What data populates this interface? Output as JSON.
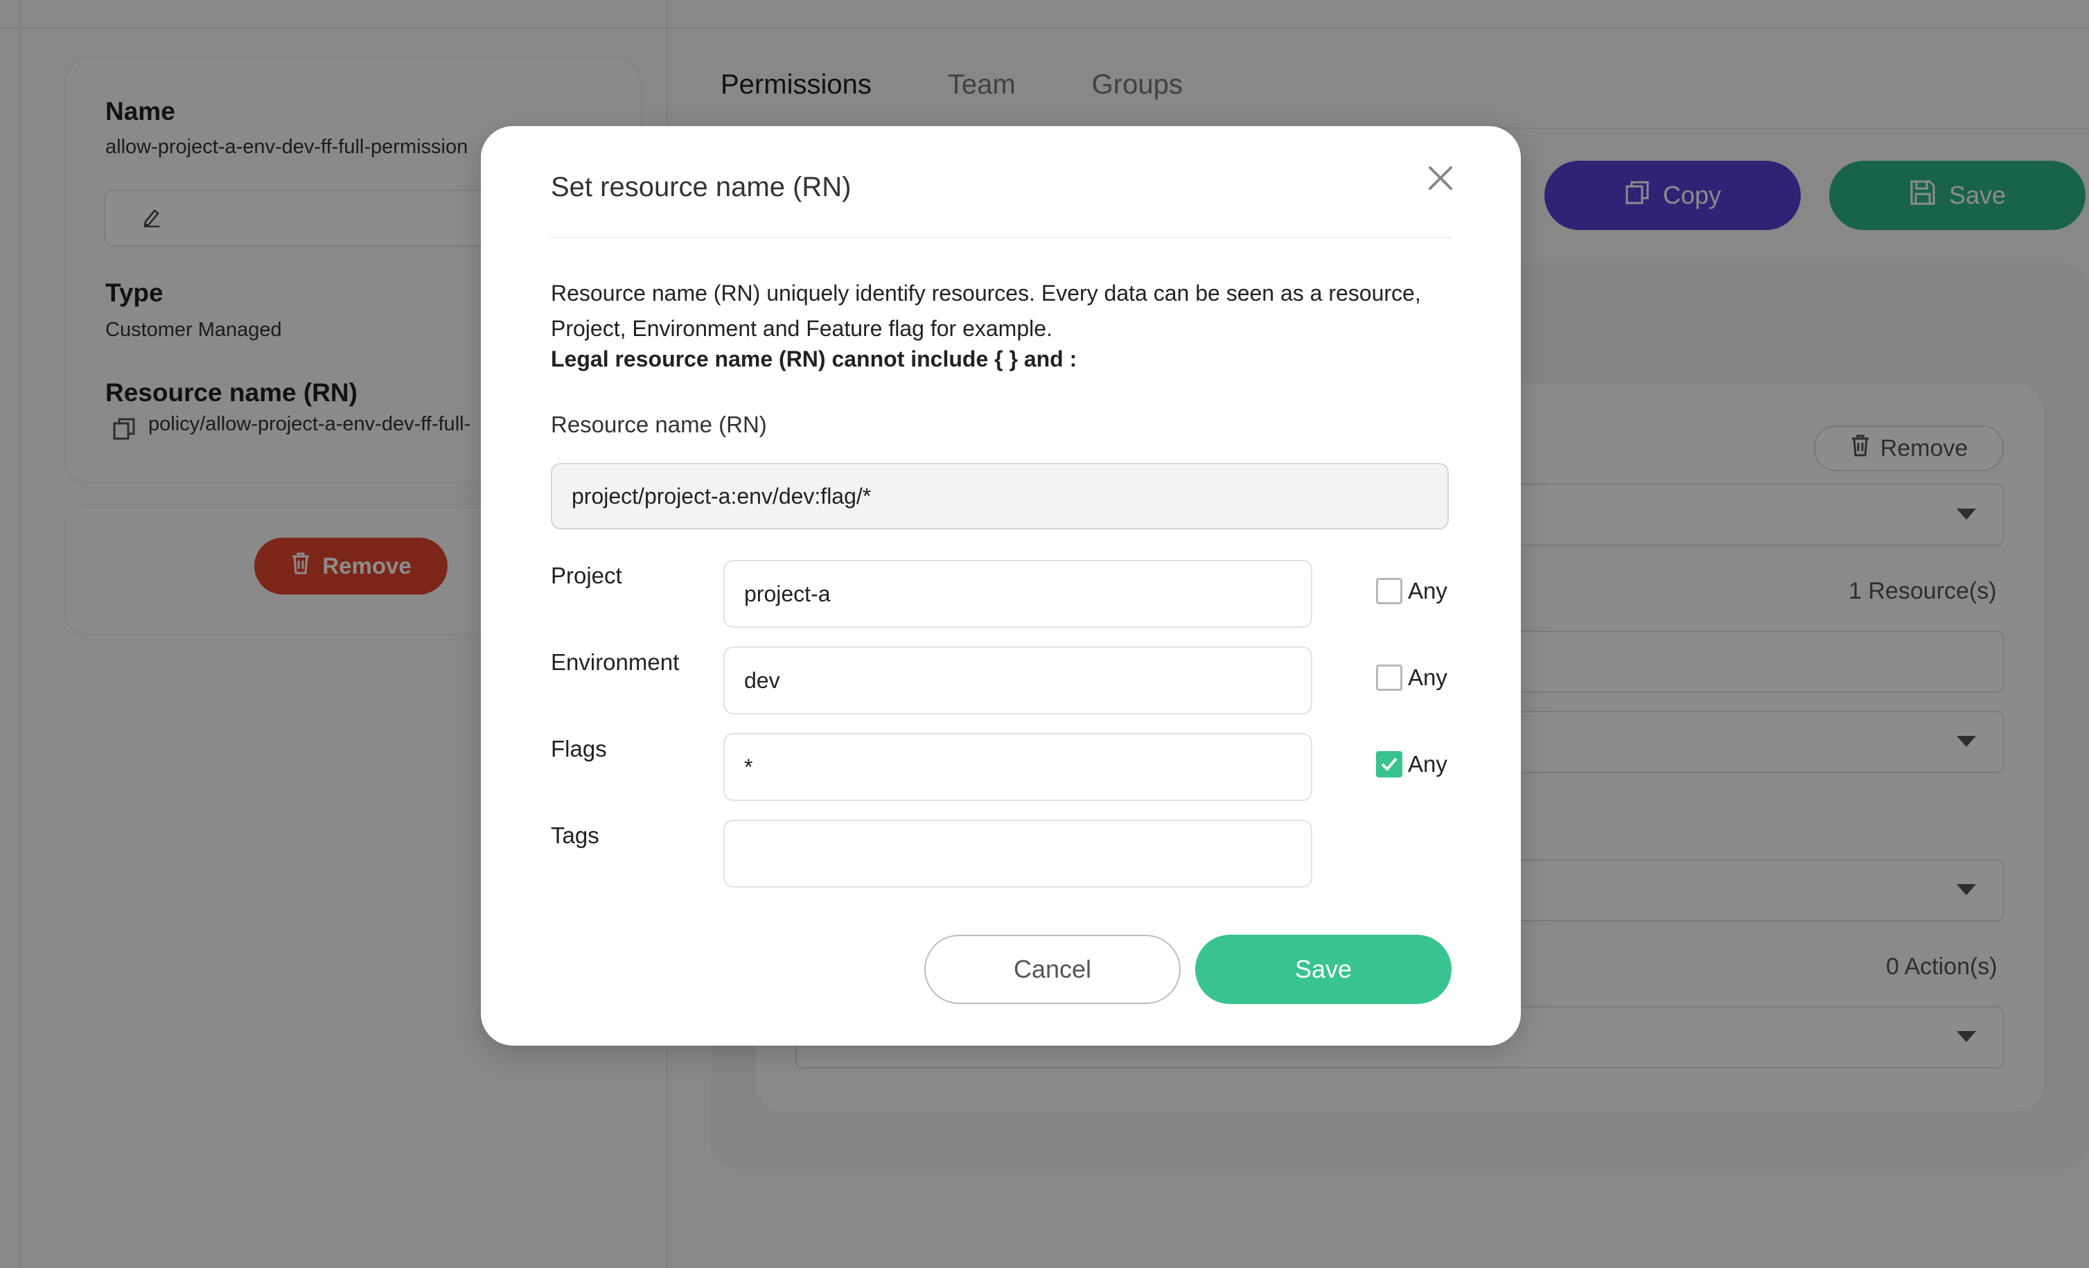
{
  "policy": {
    "name_label": "Name",
    "name_value": "allow-project-a-env-dev-ff-full-permission",
    "type_label": "Type",
    "type_value": "Customer Managed",
    "rn_label": "Resource name (RN)",
    "rn_value": "policy/allow-project-a-env-dev-ff-full-",
    "remove_label": "Remove"
  },
  "tabs": [
    {
      "label": "Permissions",
      "active": true
    },
    {
      "label": "Team",
      "active": false
    },
    {
      "label": "Groups",
      "active": false
    }
  ],
  "toolbar": {
    "copy_label": "Copy",
    "save_label": "Save"
  },
  "statement": {
    "remove_label": "Remove",
    "resources_count": "1 Resource(s)",
    "actions_count": "0 Action(s)"
  },
  "modal": {
    "title": "Set resource name (RN)",
    "description": "Resource name (RN) uniquely identify resources. Every data can be seen as a resource, Project, Environment and Feature flag for example.",
    "warning": "Legal resource name (RN) cannot include { } and :",
    "rn_label": "Resource name (RN)",
    "rn_value": "project/project-a:env/dev:flag/*",
    "fields": [
      {
        "label": "Project",
        "value": "project-a",
        "any_label": "Any",
        "any_checked": false
      },
      {
        "label": "Environment",
        "value": "dev",
        "any_label": "Any",
        "any_checked": false
      },
      {
        "label": "Flags",
        "value": "*",
        "any_label": "Any",
        "any_checked": true
      },
      {
        "label": "Tags",
        "value": ""
      }
    ],
    "cancel_label": "Cancel",
    "save_label": "Save"
  },
  "colors": {
    "accent_green": "#39c391",
    "copy_purple": "#5b3fd6",
    "remove_red": "#e2452e"
  }
}
